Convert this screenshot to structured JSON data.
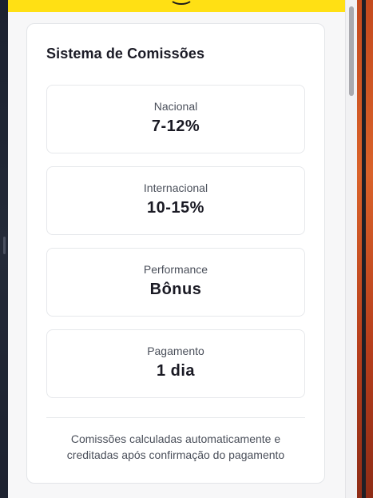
{
  "commission_panel": {
    "title": "Sistema de Comissões",
    "items": [
      {
        "label": "Nacional",
        "value": "7-12%"
      },
      {
        "label": "Internacional",
        "value": "10-15%"
      },
      {
        "label": "Performance",
        "value": "Bônus"
      },
      {
        "label": "Pagamento",
        "value": "1 dia"
      }
    ],
    "footnote": "Comissões calculadas automaticamente e creditadas após confirmação do pagamento"
  },
  "theme": {
    "accent": "#ffe014",
    "text_primary": "#1a1a24",
    "text_secondary": "#4a4f5a",
    "border": "#e6e8eb"
  },
  "icons": {
    "logo": "brand-logo-icon"
  }
}
